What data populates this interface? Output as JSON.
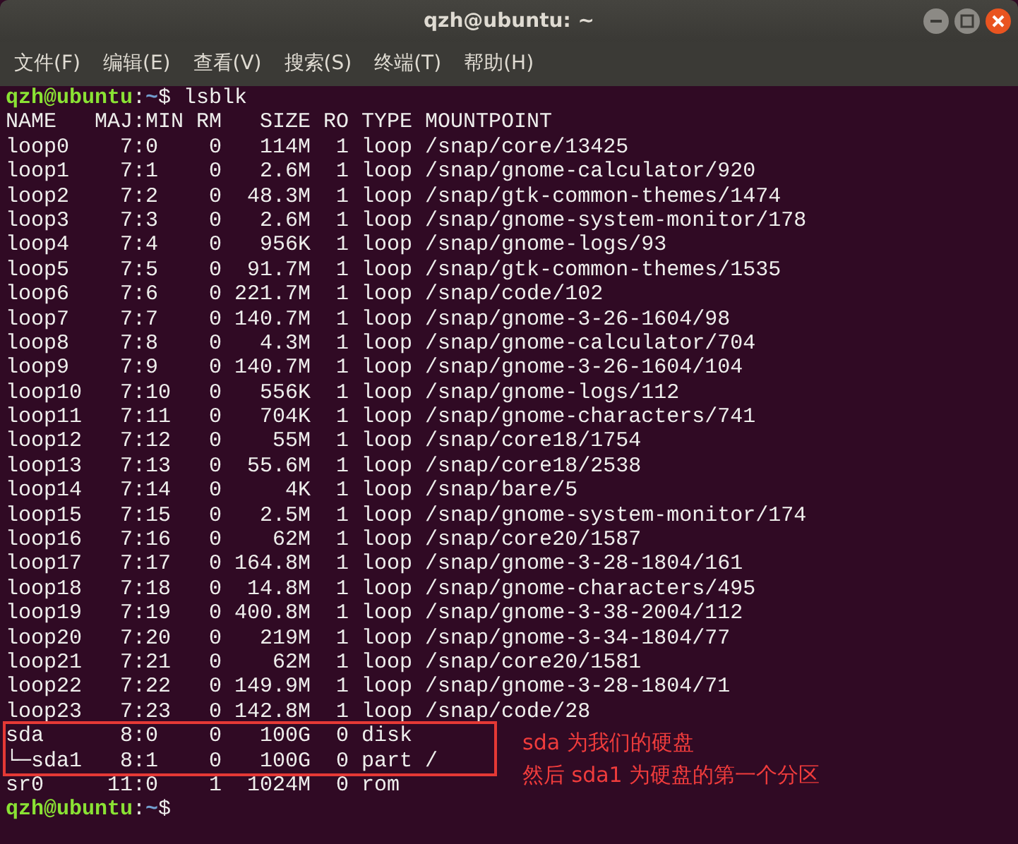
{
  "window": {
    "title": "qzh@ubuntu: ~"
  },
  "menu": [
    "文件(F)",
    "编辑(E)",
    "查看(V)",
    "搜索(S)",
    "终端(T)",
    "帮助(H)"
  ],
  "terminal": {
    "lines": [
      {
        "kind": "prompt",
        "user_host": "qzh@ubuntu",
        "separator": ":",
        "path": "~",
        "symbol": "$",
        "command": "lsblk",
        "boxed": false
      },
      {
        "kind": "output",
        "text": "NAME   MAJ:MIN RM   SIZE RO TYPE MOUNTPOINT",
        "boxed": false
      },
      {
        "kind": "output",
        "text": "loop0    7:0    0   114M  1 loop /snap/core/13425",
        "boxed": false
      },
      {
        "kind": "output",
        "text": "loop1    7:1    0   2.6M  1 loop /snap/gnome-calculator/920",
        "boxed": false
      },
      {
        "kind": "output",
        "text": "loop2    7:2    0  48.3M  1 loop /snap/gtk-common-themes/1474",
        "boxed": false
      },
      {
        "kind": "output",
        "text": "loop3    7:3    0   2.6M  1 loop /snap/gnome-system-monitor/178",
        "boxed": false
      },
      {
        "kind": "output",
        "text": "loop4    7:4    0   956K  1 loop /snap/gnome-logs/93",
        "boxed": false
      },
      {
        "kind": "output",
        "text": "loop5    7:5    0  91.7M  1 loop /snap/gtk-common-themes/1535",
        "boxed": false
      },
      {
        "kind": "output",
        "text": "loop6    7:6    0 221.7M  1 loop /snap/code/102",
        "boxed": false
      },
      {
        "kind": "output",
        "text": "loop7    7:7    0 140.7M  1 loop /snap/gnome-3-26-1604/98",
        "boxed": false
      },
      {
        "kind": "output",
        "text": "loop8    7:8    0   4.3M  1 loop /snap/gnome-calculator/704",
        "boxed": false
      },
      {
        "kind": "output",
        "text": "loop9    7:9    0 140.7M  1 loop /snap/gnome-3-26-1604/104",
        "boxed": false
      },
      {
        "kind": "output",
        "text": "loop10   7:10   0   556K  1 loop /snap/gnome-logs/112",
        "boxed": false
      },
      {
        "kind": "output",
        "text": "loop11   7:11   0   704K  1 loop /snap/gnome-characters/741",
        "boxed": false
      },
      {
        "kind": "output",
        "text": "loop12   7:12   0    55M  1 loop /snap/core18/1754",
        "boxed": false
      },
      {
        "kind": "output",
        "text": "loop13   7:13   0  55.6M  1 loop /snap/core18/2538",
        "boxed": false
      },
      {
        "kind": "output",
        "text": "loop14   7:14   0     4K  1 loop /snap/bare/5",
        "boxed": false
      },
      {
        "kind": "output",
        "text": "loop15   7:15   0   2.5M  1 loop /snap/gnome-system-monitor/174",
        "boxed": false
      },
      {
        "kind": "output",
        "text": "loop16   7:16   0    62M  1 loop /snap/core20/1587",
        "boxed": false
      },
      {
        "kind": "output",
        "text": "loop17   7:17   0 164.8M  1 loop /snap/gnome-3-28-1804/161",
        "boxed": false
      },
      {
        "kind": "output",
        "text": "loop18   7:18   0  14.8M  1 loop /snap/gnome-characters/495",
        "boxed": false
      },
      {
        "kind": "output",
        "text": "loop19   7:19   0 400.8M  1 loop /snap/gnome-3-38-2004/112",
        "boxed": false
      },
      {
        "kind": "output",
        "text": "loop20   7:20   0   219M  1 loop /snap/gnome-3-34-1804/77",
        "boxed": false
      },
      {
        "kind": "output",
        "text": "loop21   7:21   0    62M  1 loop /snap/core20/1581",
        "boxed": false
      },
      {
        "kind": "output",
        "text": "loop22   7:22   0 149.9M  1 loop /snap/gnome-3-28-1804/71",
        "boxed": false
      },
      {
        "kind": "output",
        "text": "loop23   7:23   0 142.8M  1 loop /snap/code/28",
        "boxed": false
      },
      {
        "kind": "output",
        "text": "sda      8:0    0   100G  0 disk",
        "boxed": true
      },
      {
        "kind": "output",
        "text": "└─sda1   8:1    0   100G  0 part /",
        "boxed": true
      },
      {
        "kind": "output",
        "text": "sr0     11:0    1  1024M  0 rom",
        "boxed": false
      },
      {
        "kind": "prompt",
        "user_host": "qzh@ubuntu",
        "separator": ":",
        "path": "~",
        "symbol": "$",
        "boxed": false
      }
    ]
  },
  "annotation": {
    "notes": [
      "sda 为我们的硬盘",
      "然后 sda1 为硬盘的第一个分区"
    ]
  }
}
